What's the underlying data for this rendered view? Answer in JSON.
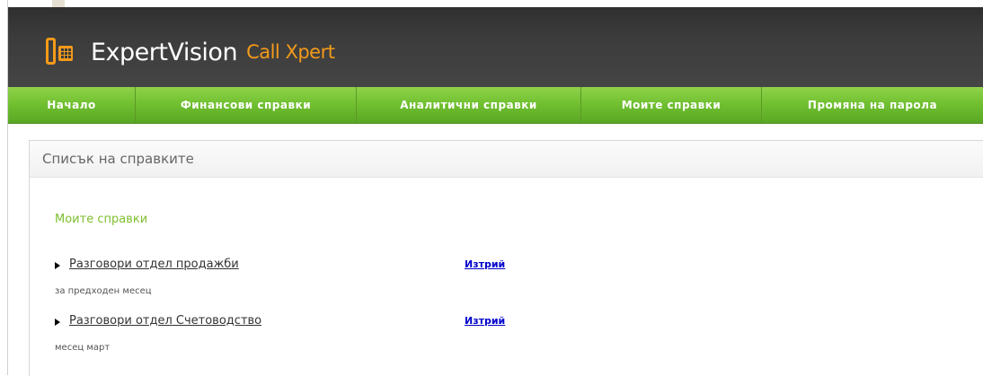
{
  "app": {
    "brand": "ExpertVision",
    "product": "Call Xpert"
  },
  "nav": {
    "items": [
      {
        "label": "Начало"
      },
      {
        "label": "Финансови справки"
      },
      {
        "label": "Аналитични справки"
      },
      {
        "label": "Моите справки"
      },
      {
        "label": "Промяна на парола"
      }
    ]
  },
  "panel": {
    "title": "Списък на справките",
    "section_title": "Моите справки",
    "reports": [
      {
        "name": "Разговори отдел продажби",
        "delete_label": "Изтрий",
        "description": "за предходен месец"
      },
      {
        "name": "Разговори отдел Счетоводство",
        "delete_label": "Изтрий",
        "description": "месец март"
      }
    ]
  },
  "colors": {
    "accent_orange": "#f39a1a",
    "nav_green": "#6fbf2f",
    "section_green": "#7fbf2f",
    "link_blue": "#0000cc"
  }
}
